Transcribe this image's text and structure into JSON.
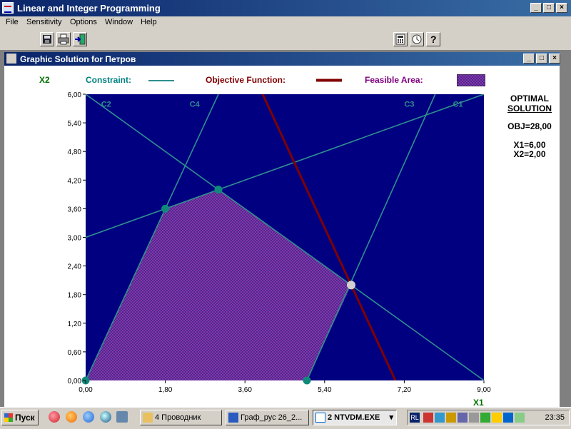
{
  "app": {
    "title": "Linear and Integer Programming"
  },
  "menu": [
    "File",
    "Sensitivity",
    "Options",
    "Window",
    "Help"
  ],
  "toolbar": {
    "icons": [
      "save-icon",
      "print-icon",
      "exit-icon",
      "calculator-icon",
      "clock-icon",
      "help-icon"
    ]
  },
  "window": {
    "title": "Graphic Solution for Петров"
  },
  "legend": {
    "y_axis": "X2",
    "x_axis": "X1",
    "constraint": "Constraint:",
    "objective": "Objective Function:",
    "feasible": "Feasible Area:"
  },
  "colors": {
    "plot_bg": "#000080",
    "constraint": "#2f8f8f",
    "objective": "#800000",
    "feasible": "#6a2a8a",
    "label_green": "#007000",
    "label_teal": "#008080",
    "label_maroon": "#800000",
    "label_purple": "#800080"
  },
  "optimal": {
    "heading_1": "OPTIMAL",
    "heading_2": "SOLUTION",
    "obj": "OBJ=28,00",
    "x1": "X1=6,00",
    "x2": "X2=2,00"
  },
  "chart_data": {
    "type": "line",
    "xlabel": "X1",
    "ylabel": "X2",
    "xlim": [
      0,
      9
    ],
    "ylim": [
      0,
      6
    ],
    "xticks": [
      "0,00",
      "1,80",
      "3,60",
      "5,40",
      "7,20",
      "9,00"
    ],
    "yticks": [
      "0,00",
      "0,60",
      "1,20",
      "1,80",
      "2,40",
      "3,00",
      "3,60",
      "4,20",
      "4,80",
      "5,40",
      "6,00"
    ],
    "constraints": [
      {
        "name": "C1",
        "p1": [
          0,
          3
        ],
        "p2": [
          9,
          6
        ]
      },
      {
        "name": "C2",
        "p1": [
          0,
          6
        ],
        "p2": [
          9,
          0
        ]
      },
      {
        "name": "C3",
        "p1": [
          5,
          0
        ],
        "p2": [
          7.9,
          6
        ]
      },
      {
        "name": "C4",
        "p1": [
          0,
          0
        ],
        "p2": [
          3,
          6
        ]
      }
    ],
    "objective": {
      "p1": [
        4,
        6
      ],
      "p2": [
        7,
        0
      ]
    },
    "feasible_region": [
      [
        0,
        0
      ],
      [
        1.8,
        3.6
      ],
      [
        3,
        4
      ],
      [
        6,
        2
      ],
      [
        5,
        0
      ]
    ],
    "vertices": [
      [
        0,
        0
      ],
      [
        1.8,
        3.6
      ],
      [
        3,
        4
      ],
      [
        5,
        0
      ]
    ],
    "optimal_point": [
      6,
      2
    ]
  },
  "taskbar": {
    "start": "Пуск",
    "tasks": [
      "4 Проводник",
      "Граф_рус 26_2...",
      "2 NTVDM.EXE"
    ],
    "lang": "RL",
    "clock": "23:35"
  }
}
